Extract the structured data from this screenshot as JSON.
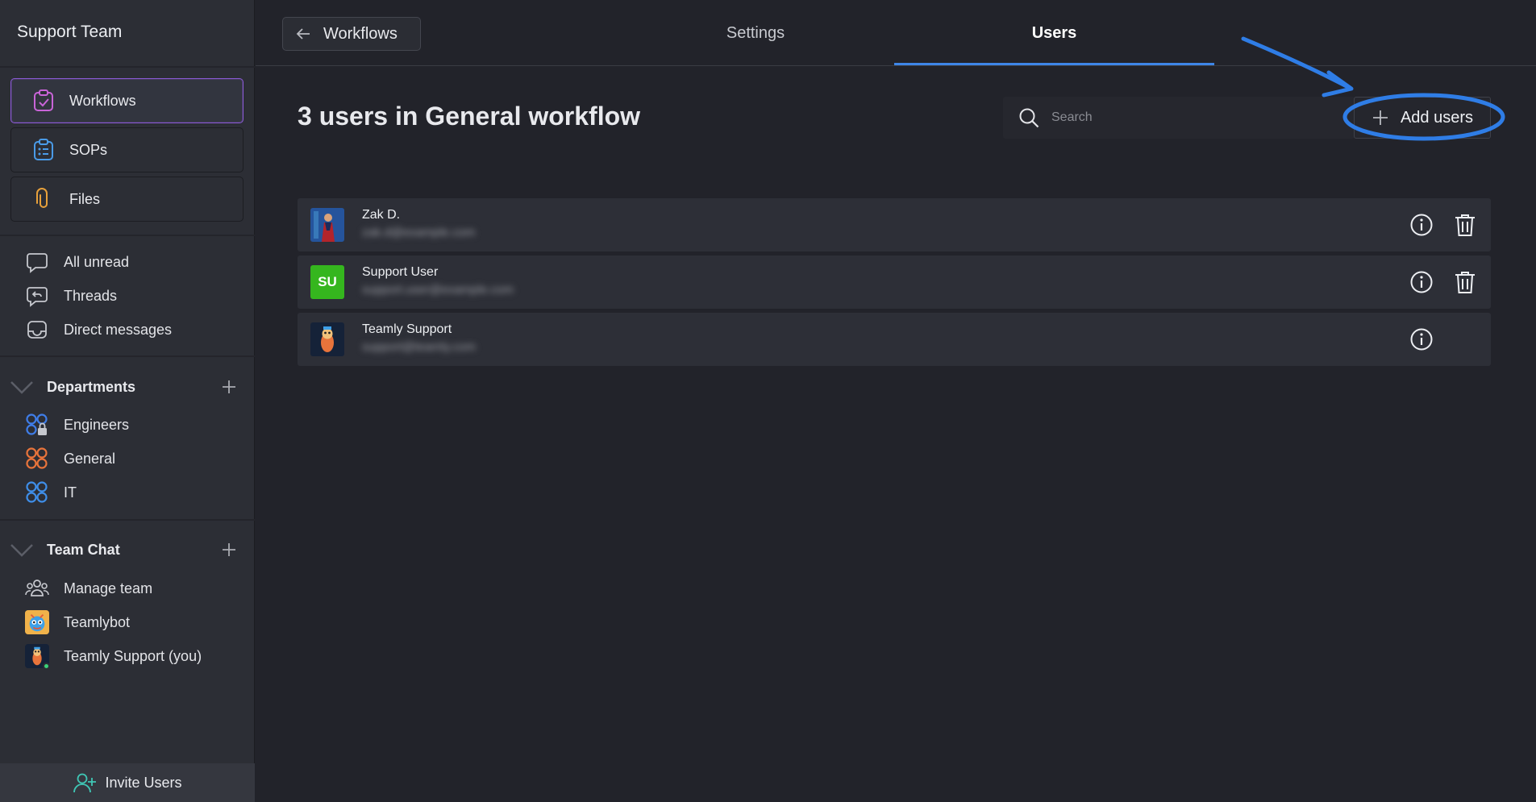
{
  "sidebar": {
    "team_name": "Support Team",
    "main_nav": [
      {
        "label": "Workflows",
        "icon": "clipboard-check-icon",
        "active": true
      },
      {
        "label": "SOPs",
        "icon": "clipboard-list-icon",
        "active": false
      },
      {
        "label": "Files",
        "icon": "paperclip-icon",
        "active": false
      }
    ],
    "inbox": [
      {
        "label": "All unread",
        "icon": "chat-bubble-icon"
      },
      {
        "label": "Threads",
        "icon": "threads-icon"
      },
      {
        "label": "Direct messages",
        "icon": "inbox-icon"
      }
    ],
    "departments": {
      "title": "Departments",
      "items": [
        {
          "label": "Engineers",
          "icon": "group-lock-icon",
          "color": "#3f7de8"
        },
        {
          "label": "General",
          "icon": "group-icon",
          "color": "#e8743b"
        },
        {
          "label": "IT",
          "icon": "group-icon",
          "color": "#3f8ee8"
        }
      ]
    },
    "team_chat": {
      "title": "Team Chat",
      "items": [
        {
          "label": "Manage team",
          "icon": "people-icon"
        },
        {
          "label": "Teamlybot",
          "icon": "bot-avatar"
        },
        {
          "label": "Teamly Support (you)",
          "icon": "support-avatar"
        }
      ]
    },
    "invite_label": "Invite Users"
  },
  "topbar": {
    "back_label": "Workflows",
    "tabs": [
      {
        "label": "Settings",
        "active": false
      },
      {
        "label": "Users",
        "active": true
      }
    ]
  },
  "main": {
    "title": "3 users in General workflow",
    "search_placeholder": "Search",
    "add_users_label": "Add users",
    "users": [
      {
        "name": "Zak D.",
        "email": "zak.d@example.com",
        "avatar": "photo",
        "deletable": true
      },
      {
        "name": "Support User",
        "email": "support.user@example.com",
        "avatar": "SU",
        "avatar_color": "#35b61e",
        "deletable": true
      },
      {
        "name": "Teamly Support",
        "email": "support@teamly.com",
        "avatar": "mascot",
        "deletable": false
      }
    ]
  },
  "colors": {
    "accent_blue": "#3e86e8",
    "active_border": "#8b5ad6",
    "background": "#22232a",
    "sidebar": "#2c2e35"
  }
}
